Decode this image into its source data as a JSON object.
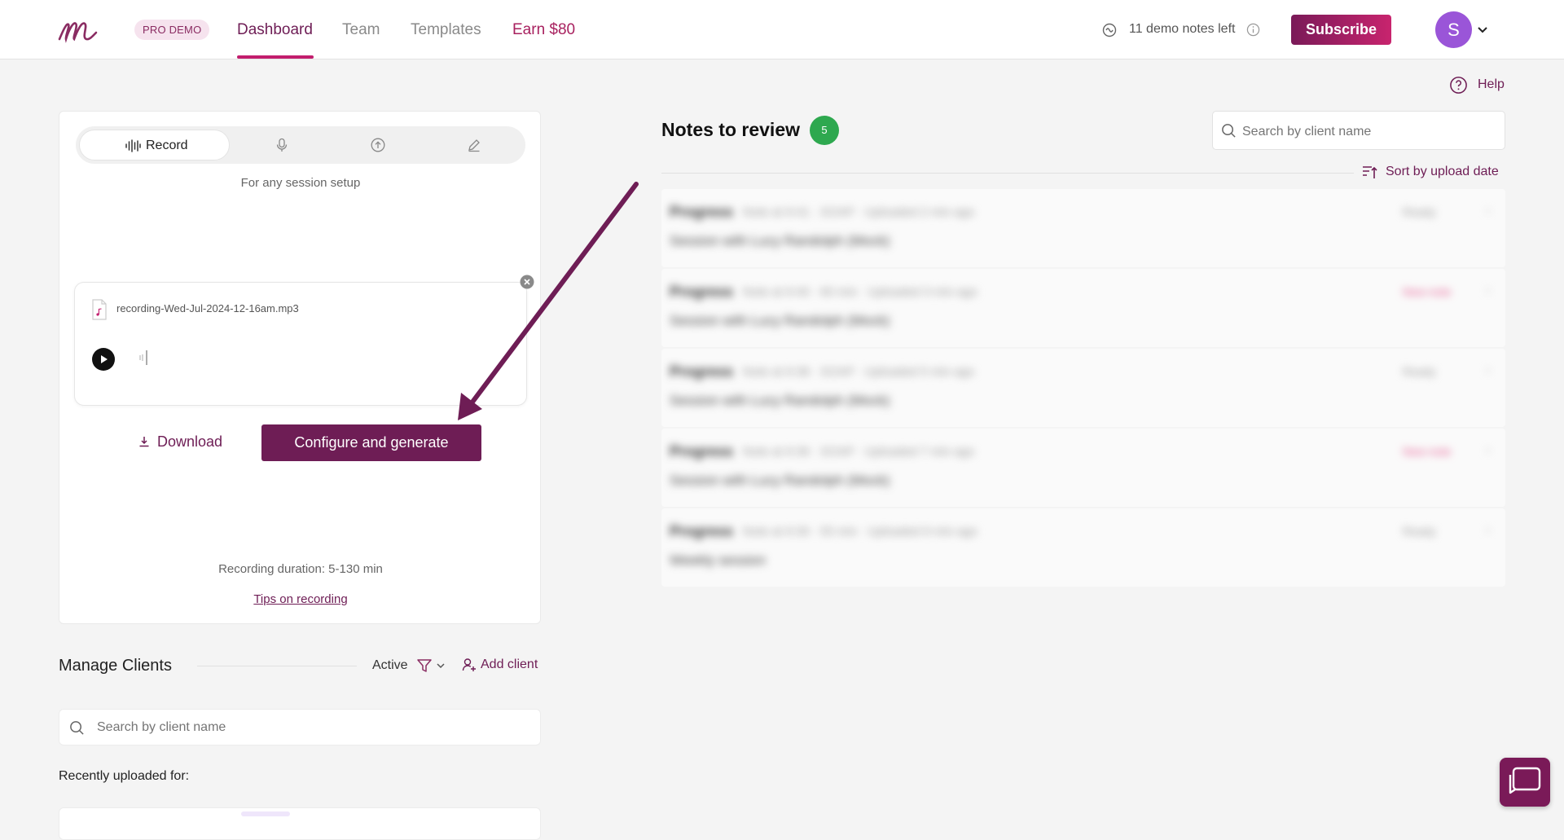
{
  "header": {
    "pro_badge": "PRO DEMO",
    "nav": [
      "Dashboard",
      "Team",
      "Templates",
      "Earn $80"
    ],
    "demo_notes": "11 demo notes left",
    "subscribe_label": "Subscribe",
    "avatar_initial": "S",
    "help_label": "Help",
    "colors": {
      "brand": "#6e1d55",
      "accent": "#c21d6d",
      "avatar": "#9a55d8"
    }
  },
  "recorder": {
    "mode_record_label": "Record",
    "modes": [
      "waveform-icon",
      "microphone-icon",
      "upload-icon",
      "pencil-icon"
    ],
    "setup_text": "For any session setup",
    "file_name": "recording-Wed-Jul-2024-12-16am.mp3",
    "download_label": "Download",
    "configure_label": "Configure and generate",
    "duration_text": "Recording duration: 5-130 min",
    "tips_label": "Tips on recording"
  },
  "clients": {
    "title": "Manage Clients",
    "filter_label": "Active",
    "add_label": "Add client",
    "search_placeholder": "Search by client name",
    "recent_label": "Recently uploaded for:"
  },
  "notes": {
    "title": "Notes to review",
    "count": "5",
    "count_color": "#2ea84f",
    "search_placeholder": "Search by client name",
    "sort_label": "Sort by upload date",
    "rows": [
      {
        "title": "Progress",
        "meta": "Note at 9:41 · SOAP · Uploaded 2 min ago",
        "sub": "Session with Lucy Randolph (Mock)",
        "status": "Ready",
        "pink": false
      },
      {
        "title": "Progress",
        "meta": "Note at 9:40 · 60 min · Uploaded 3 min ago",
        "sub": "Session with Lucy Randolph (Mock)",
        "status": "New note",
        "pink": true
      },
      {
        "title": "Progress",
        "meta": "Note at 9:38 · SOAP · Uploaded 5 min ago",
        "sub": "Session with Lucy Randolph (Mock)",
        "status": "Ready",
        "pink": false
      },
      {
        "title": "Progress",
        "meta": "Note at 9:36 · SOAP · Uploaded 7 min ago",
        "sub": "Session with Lucy Randolph (Mock)",
        "status": "New note",
        "pink": true
      },
      {
        "title": "Progress",
        "meta": "Note at 9:30 · 55 min · Uploaded 9 min ago",
        "sub": "Weekly session",
        "status": "Ready",
        "pink": false
      }
    ]
  }
}
